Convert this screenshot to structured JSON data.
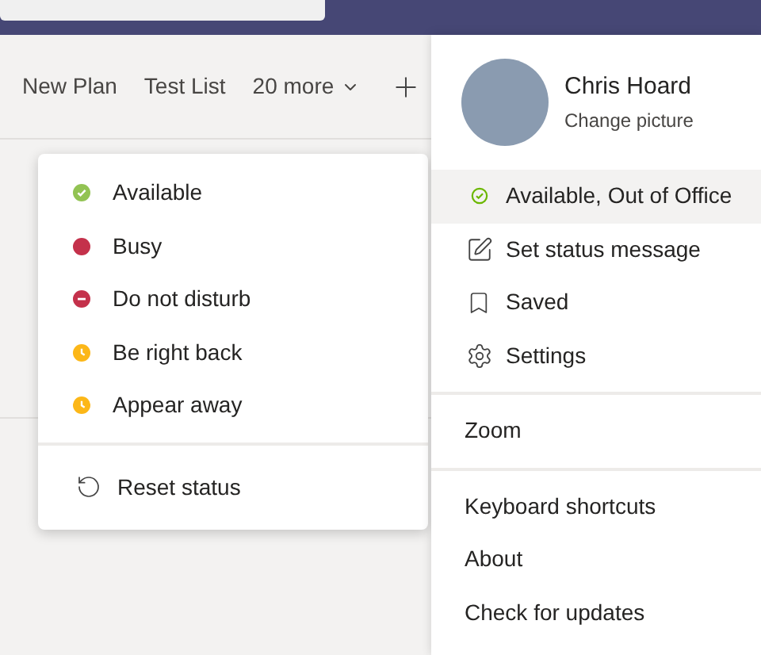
{
  "tabs": [
    {
      "label": "New Plan"
    },
    {
      "label": "Test List"
    },
    {
      "label": "20 more",
      "kind": "more"
    }
  ],
  "status_menu": {
    "items": [
      {
        "label": "Available",
        "kind": "available",
        "color": "#92c353"
      },
      {
        "label": "Busy",
        "kind": "busy",
        "color": "#c4314b"
      },
      {
        "label": "Do not disturb",
        "kind": "dnd",
        "color": "#c4314b"
      },
      {
        "label": "Be right back",
        "kind": "away",
        "color": "#fcb718"
      },
      {
        "label": "Appear away",
        "kind": "away",
        "color": "#fcb718"
      }
    ],
    "reset": "Reset status"
  },
  "profile": {
    "name": "Chris Hoard",
    "change_picture": "Change picture",
    "items": [
      {
        "label": "Available, Out of Office",
        "kind": "status",
        "selected": true
      },
      {
        "label": "Set status message",
        "kind": "message",
        "selected": false
      },
      {
        "label": "Saved",
        "kind": "saved",
        "selected": false
      },
      {
        "label": "Settings",
        "kind": "settings",
        "selected": false
      }
    ],
    "groups": [
      [
        "Zoom"
      ],
      [
        "Keyboard shortcuts",
        "About",
        "Check for updates"
      ]
    ]
  }
}
